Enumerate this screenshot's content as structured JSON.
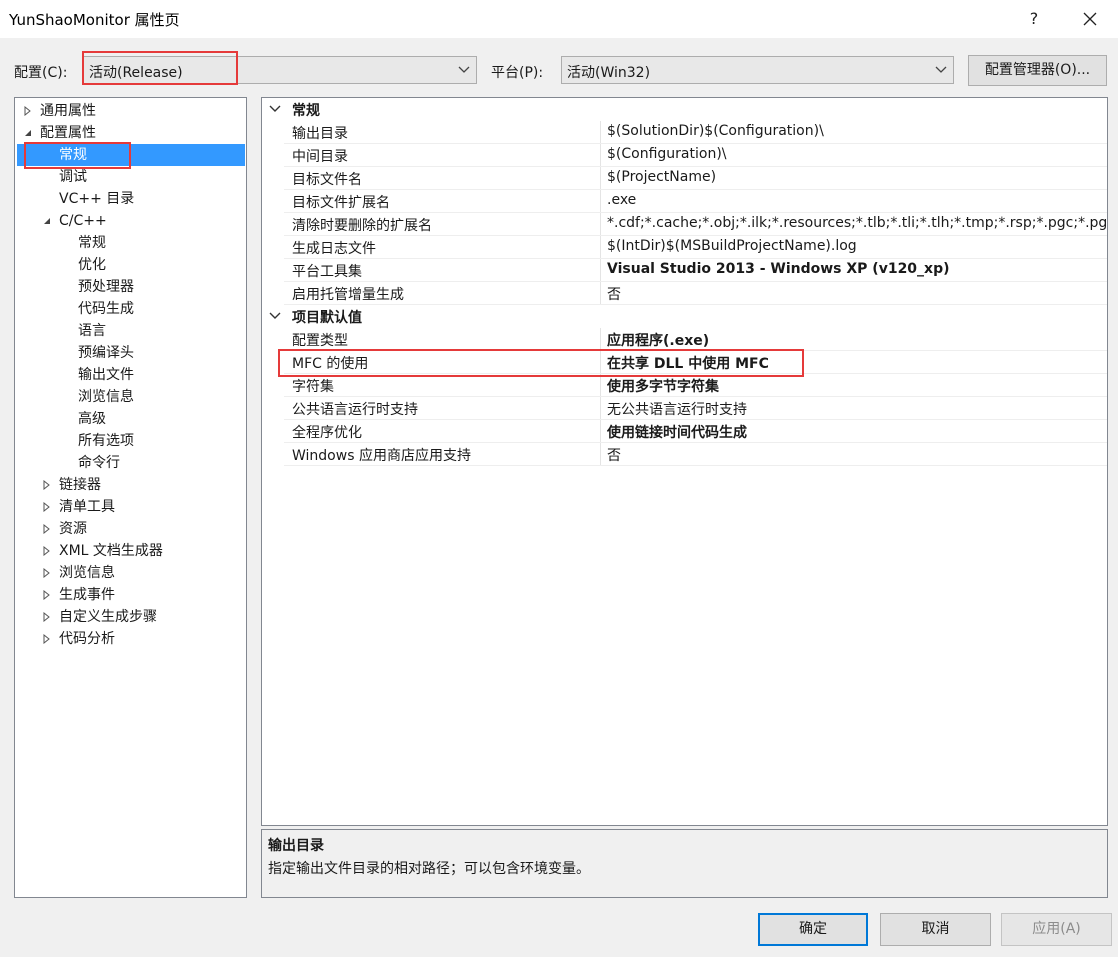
{
  "window": {
    "title": "YunShaoMonitor 属性页",
    "help": "?",
    "close_icon": "close-icon"
  },
  "toolbar": {
    "config_label": "配置(C):",
    "config_value": "活动(Release)",
    "platform_label": "平台(P):",
    "platform_value": "活动(Win32)",
    "config_manager_button": "配置管理器(O)..."
  },
  "tree": {
    "items": [
      {
        "label": "通用属性",
        "expander": "collapsed"
      },
      {
        "label": "配置属性",
        "expander": "expanded"
      },
      {
        "label": "常规",
        "expander": "none",
        "selected": true
      },
      {
        "label": "调试",
        "expander": "none"
      },
      {
        "label": "VC++ 目录",
        "expander": "none"
      },
      {
        "label": "C/C++",
        "expander": "expanded"
      },
      {
        "label": "常规",
        "expander": "none"
      },
      {
        "label": "优化",
        "expander": "none"
      },
      {
        "label": "预处理器",
        "expander": "none"
      },
      {
        "label": "代码生成",
        "expander": "none"
      },
      {
        "label": "语言",
        "expander": "none"
      },
      {
        "label": "预编译头",
        "expander": "none"
      },
      {
        "label": "输出文件",
        "expander": "none"
      },
      {
        "label": "浏览信息",
        "expander": "none"
      },
      {
        "label": "高级",
        "expander": "none"
      },
      {
        "label": "所有选项",
        "expander": "none"
      },
      {
        "label": "命令行",
        "expander": "none"
      },
      {
        "label": "链接器",
        "expander": "collapsed"
      },
      {
        "label": "清单工具",
        "expander": "collapsed"
      },
      {
        "label": "资源",
        "expander": "collapsed"
      },
      {
        "label": "XML 文档生成器",
        "expander": "collapsed"
      },
      {
        "label": "浏览信息",
        "expander": "collapsed"
      },
      {
        "label": "生成事件",
        "expander": "collapsed"
      },
      {
        "label": "自定义生成步骤",
        "expander": "collapsed"
      },
      {
        "label": "代码分析",
        "expander": "collapsed"
      }
    ]
  },
  "grid": {
    "sections": [
      {
        "title": "常规",
        "rows": [
          {
            "name": "输出目录",
            "value": "$(SolutionDir)$(Configuration)\\",
            "bold": false
          },
          {
            "name": "中间目录",
            "value": "$(Configuration)\\",
            "bold": false
          },
          {
            "name": "目标文件名",
            "value": "$(ProjectName)",
            "bold": false
          },
          {
            "name": "目标文件扩展名",
            "value": ".exe",
            "bold": false
          },
          {
            "name": "清除时要删除的扩展名",
            "value": "*.cdf;*.cache;*.obj;*.ilk;*.resources;*.tlb;*.tli;*.tlh;*.tmp;*.rsp;*.pgc;*.pgd;*.meta;*.tlog;*.manifest;*.res;*.pch;*.exp;*.idb;*.rep;*.xdc;*.pdb;*_manifest.rc;*.bsc;*.sbr;*.xml;*.metagen;*.bi",
            "bold": false
          },
          {
            "name": "生成日志文件",
            "value": "$(IntDir)$(MSBuildProjectName).log",
            "bold": false
          },
          {
            "name": "平台工具集",
            "value": "Visual Studio 2013 - Windows XP (v120_xp)",
            "bold": true
          },
          {
            "name": "启用托管增量生成",
            "value": "否",
            "bold": false
          }
        ]
      },
      {
        "title": "项目默认值",
        "rows": [
          {
            "name": "配置类型",
            "value": "应用程序(.exe)",
            "bold": true
          },
          {
            "name": "MFC 的使用",
            "value": "在共享 DLL 中使用 MFC",
            "bold": true
          },
          {
            "name": "字符集",
            "value": "使用多字节字符集",
            "bold": true
          },
          {
            "name": "公共语言运行时支持",
            "value": "无公共语言运行时支持",
            "bold": false
          },
          {
            "name": "全程序优化",
            "value": "使用链接时间代码生成",
            "bold": true
          },
          {
            "name": "Windows 应用商店应用支持",
            "value": "否",
            "bold": false
          }
        ]
      }
    ]
  },
  "description": {
    "title": "输出目录",
    "text": "指定输出文件目录的相对路径；可以包含环境变量。"
  },
  "buttons": {
    "ok": "确定",
    "cancel": "取消",
    "apply": "应用(A)"
  },
  "colors": {
    "selection": "#3399ff",
    "highlight_box": "#e53a3a",
    "primary_border": "#0078d7"
  }
}
